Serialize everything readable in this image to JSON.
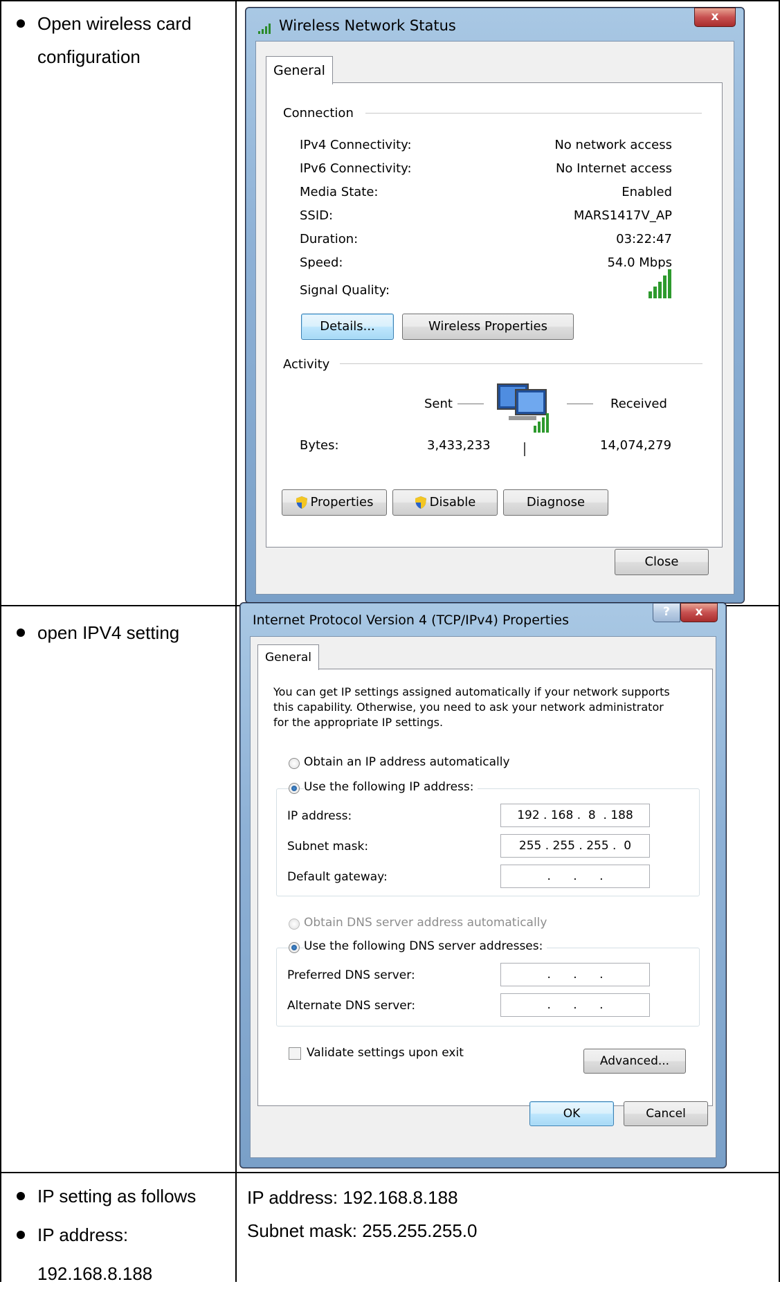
{
  "rows": [
    {
      "left": [
        "Open wireless card",
        "configuration"
      ]
    },
    {
      "left": [
        "open IPV4 setting"
      ]
    },
    {
      "left": [
        "IP setting as follows",
        "IP address:",
        "192.168.8.188"
      ],
      "right": [
        "IP address: 192.168.8.188",
        "Subnet mask: 255.255.255.0"
      ]
    }
  ],
  "status_dialog": {
    "title": "Wireless Network Status",
    "close_glyph": "x",
    "tab": "General",
    "connection_label": "Connection",
    "fields": [
      {
        "label": "IPv4 Connectivity:",
        "value": "No network access"
      },
      {
        "label": "IPv6 Connectivity:",
        "value": "No Internet access"
      },
      {
        "label": "Media State:",
        "value": "Enabled"
      },
      {
        "label": "SSID:",
        "value": "MARS1417V_AP"
      },
      {
        "label": "Duration:",
        "value": "03:22:47"
      },
      {
        "label": "Speed:",
        "value": "54.0 Mbps"
      }
    ],
    "signal_label": "Signal Quality:",
    "signal_bars": 5,
    "details_btn": "Details...",
    "wireless_props_btn": "Wireless Properties",
    "activity_label": "Activity",
    "sent_label": "Sent",
    "received_label": "Received",
    "bytes_label": "Bytes:",
    "bytes_sent": "3,433,233",
    "bytes_received": "14,074,279",
    "properties_btn": "Properties",
    "disable_btn": "Disable",
    "diagnose_btn": "Diagnose",
    "close_btn": "Close"
  },
  "ipv4_dialog": {
    "title": "Internet Protocol Version 4 (TCP/IPv4) Properties",
    "help_glyph": "?",
    "close_glyph": "x",
    "tab": "General",
    "intro": [
      "You can get IP settings assigned automatically if your network supports",
      "this capability. Otherwise, you need to ask your network administrator",
      "for the appropriate IP settings."
    ],
    "obtain_ip_auto": "Obtain an IP address automatically",
    "use_following_ip": "Use the following IP address:",
    "ip_label": "IP address:",
    "ip_value": "192 . 168 .  8  . 188",
    "mask_label": "Subnet mask:",
    "mask_value": "255 . 255 . 255 .  0",
    "gateway_label": "Default gateway:",
    "gateway_value": " .      .      . ",
    "obtain_dns_auto": "Obtain DNS server address automatically",
    "use_following_dns": "Use the following DNS server addresses:",
    "pref_dns_label": "Preferred DNS server:",
    "pref_dns_value": " .      .      . ",
    "alt_dns_label": "Alternate DNS server:",
    "alt_dns_value": " .      .      . ",
    "validate_label": "Validate settings upon exit",
    "advanced_btn": "Advanced...",
    "ok_btn": "OK",
    "cancel_btn": "Cancel"
  }
}
